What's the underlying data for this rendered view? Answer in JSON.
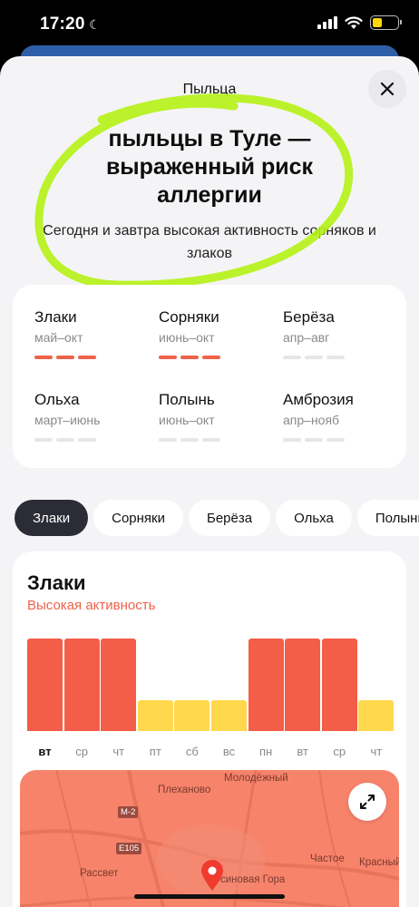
{
  "status_bar": {
    "time": "17:20",
    "battery_level": 0.38,
    "icons": [
      "moon-icon",
      "signal-icon",
      "wifi-icon",
      "battery-icon"
    ]
  },
  "sheet": {
    "title": "Пыльца",
    "headline_lines": [
      "пыльцы в Туле —",
      "выраженный риск",
      "аллергии"
    ],
    "subhead": "Сегодня и завтра высокая активность сорняков и злаков",
    "highlight_color": "#b5f215"
  },
  "pollen_types": [
    {
      "name": "Злаки",
      "season": "май–окт",
      "level": 3
    },
    {
      "name": "Сорняки",
      "season": "июнь–окт",
      "level": 3
    },
    {
      "name": "Берёза",
      "season": "апр–авг",
      "level": 0
    },
    {
      "name": "Ольха",
      "season": "март–июнь",
      "level": 0
    },
    {
      "name": "Полынь",
      "season": "июнь–окт",
      "level": 0
    },
    {
      "name": "Амброзия",
      "season": "апр–нояб",
      "level": 0
    }
  ],
  "chips": [
    "Злаки",
    "Сорняки",
    "Берёза",
    "Ольха",
    "Полынь"
  ],
  "active_chip": 0,
  "forecast": {
    "title": "Злаки",
    "activity": "Высокая активность",
    "colors": {
      "high": "#f45d48",
      "medium": "#ffd84d",
      "low": "#e6e6ea"
    },
    "days": [
      {
        "label": "вт",
        "level": "high",
        "value": 3,
        "today": true
      },
      {
        "label": "ср",
        "level": "high",
        "value": 3
      },
      {
        "label": "чт",
        "level": "high",
        "value": 3
      },
      {
        "label": "пт",
        "level": "medium",
        "value": 1
      },
      {
        "label": "сб",
        "level": "medium",
        "value": 1
      },
      {
        "label": "вс",
        "level": "medium",
        "value": 1
      },
      {
        "label": "пн",
        "level": "high",
        "value": 3
      },
      {
        "label": "вт",
        "level": "high",
        "value": 3
      },
      {
        "label": "ср",
        "level": "high",
        "value": 3
      },
      {
        "label": "чт",
        "level": "medium",
        "value": 1
      }
    ]
  },
  "map": {
    "labels": [
      "Молодёжный",
      "Плеханово",
      "Рассвет",
      "Осиновая Гора",
      "Частое",
      "Красный"
    ],
    "roads": [
      "М-2",
      "Е105"
    ]
  }
}
